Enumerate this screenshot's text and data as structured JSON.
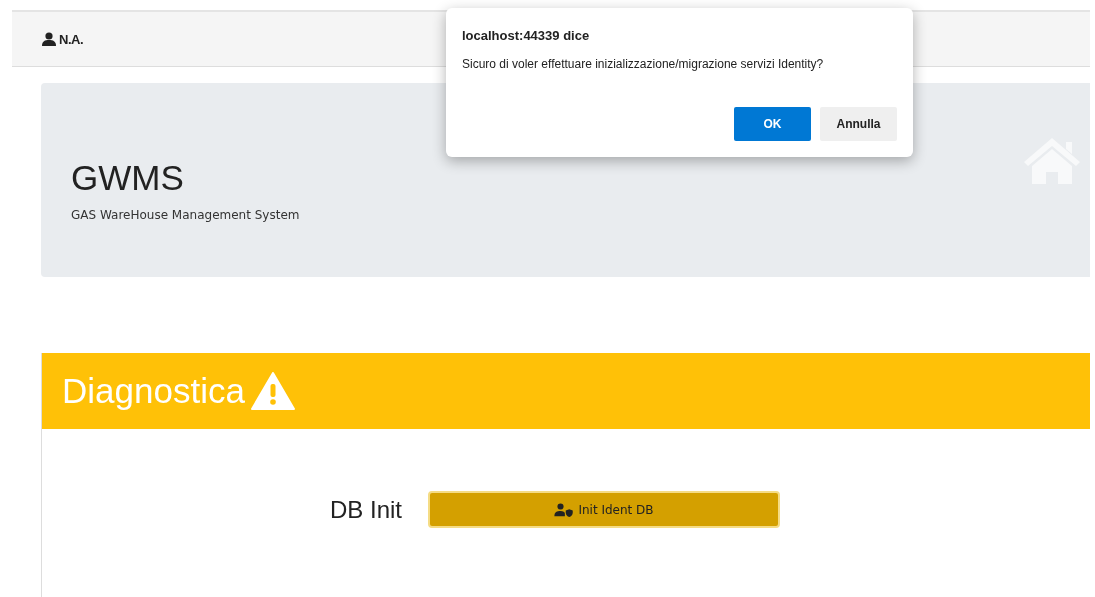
{
  "navbar": {
    "user": "N.A."
  },
  "jumbotron": {
    "title": "GWMS",
    "subtitle": "GAS WareHouse Management System"
  },
  "diagnostics": {
    "title": "Diagnostica",
    "rows": [
      {
        "label": "DB Init",
        "button": "Init Ident DB"
      }
    ]
  },
  "dialog": {
    "title": "localhost:44339 dice",
    "message": "Sicuro di voler effettuare inizializzazione/migrazione servizi Identity?",
    "buttons": [
      {
        "label": "OK",
        "kind": "primary"
      },
      {
        "label": "Annulla",
        "kind": "secondary"
      }
    ]
  }
}
